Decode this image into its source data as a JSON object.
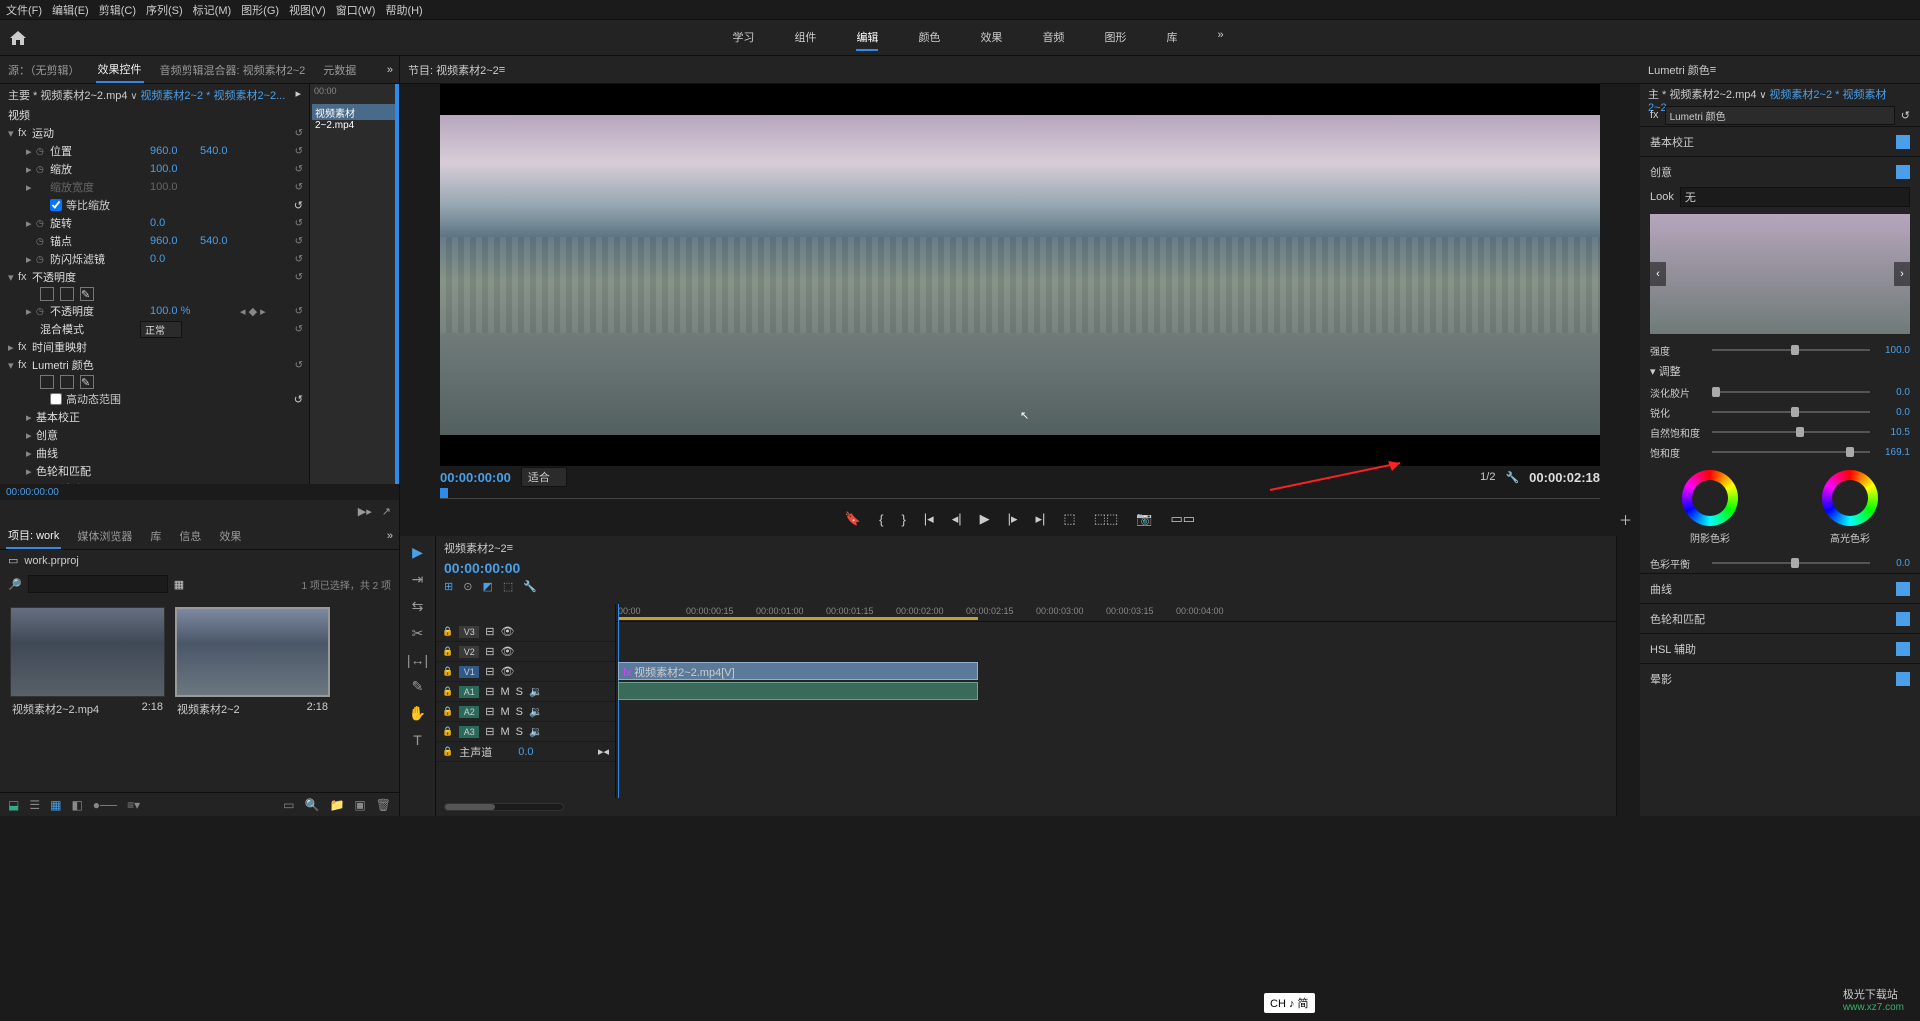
{
  "menu": {
    "file": "文件(F)",
    "edit": "编辑(E)",
    "clip": "剪辑(C)",
    "sequence": "序列(S)",
    "markers": "标记(M)",
    "graphics": "图形(G)",
    "view": "视图(V)",
    "window": "窗口(W)",
    "help": "帮助(H)"
  },
  "workspaces": {
    "learn": "学习",
    "assembly": "组件",
    "editing": "编辑",
    "color": "颜色",
    "effects": "效果",
    "audio": "音频",
    "graphics": "图形",
    "libraries": "库"
  },
  "source_tabs": {
    "source": "源：（无剪辑）",
    "effect_controls": "效果控件",
    "audio_mixer": "音频剪辑混合器: 视频素材2~2",
    "metadata": "元数据"
  },
  "effect": {
    "crumb_main": "主要 * 视频素材2~2.mp4",
    "crumb_link": "视频素材2~2 * 视频素材2~2...",
    "clip_tag": "视频素材2~2.mp4",
    "ruler_start": "00:00",
    "video_header": "视频",
    "motion": {
      "label": "运动",
      "position": "位置",
      "pos_x": "960.0",
      "pos_y": "540.0",
      "scale": "缩放",
      "scale_v": "100.0",
      "scale_width": "缩放宽度",
      "scale_width_v": "100.0",
      "uniform": "等比缩放",
      "rotation": "旋转",
      "rotation_v": "0.0",
      "anchor": "锚点",
      "anchor_x": "960.0",
      "anchor_y": "540.0",
      "antiflicker": "防闪烁滤镜",
      "antiflicker_v": "0.0"
    },
    "opacity": {
      "label": "不透明度",
      "value_lbl": "不透明度",
      "value": "100.0 %",
      "blend_lbl": "混合模式",
      "blend_v": "正常"
    },
    "time_remap": "时间重映射",
    "lumetri": {
      "label": "Lumetri 颜色",
      "hdr": "高动态范围",
      "basic": "基本校正",
      "creative": "创意",
      "curves": "曲线",
      "wheels": "色轮和匹配",
      "hsl": "HSL 辅助"
    },
    "timecode": "00:00:00:00"
  },
  "program": {
    "tab": "节目: 视频素材2~2",
    "tc": "00:00:00:00",
    "fit": "适合",
    "zoom": "1/2",
    "duration": "00:00:02:18"
  },
  "project": {
    "tab_project": "项目: work",
    "tab_browser": "媒体浏览器",
    "tab_lib": "库",
    "tab_info": "信息",
    "tab_effects": "效果",
    "path": "work.prproj",
    "search_placeholder": "",
    "status": "1 项已选择，共 2 项",
    "items": [
      {
        "name": "视频素材2~2.mp4",
        "dur": "2:18"
      },
      {
        "name": "视频素材2~2",
        "dur": "2:18"
      }
    ]
  },
  "timeline": {
    "tab": "视频素材2~2",
    "tc": "00:00:00:00",
    "ticks": [
      "00:00",
      "00:00:00:15",
      "00:00:01:00",
      "00:00:01:15",
      "00:00:02:00",
      "00:00:02:15",
      "00:00:03:00",
      "00:00:03:15",
      "00:00:04:00"
    ],
    "tracks": {
      "v3": "V3",
      "v2": "V2",
      "v1": "V1",
      "a1": "A1",
      "a2": "A2",
      "a3": "A3",
      "master": "主声道",
      "master_v": "0.0"
    },
    "clip_name": "视频素材2~2.mp4[V]",
    "ms": "M",
    "ss": "S"
  },
  "lumetri": {
    "title": "Lumetri 颜色",
    "crumb1": "主 * 视频素材2~2.mp4",
    "crumb2": "视频素材2~2 * 视频素材2~2...",
    "fx": "fx",
    "preset": "Lumetri 颜色",
    "basic": "基本校正",
    "creative": "创意",
    "look_lbl": "Look",
    "look_v": "无",
    "intensity": "强度",
    "intensity_v": "100.0",
    "adjust": "调整",
    "fade": "淡化胶片",
    "fade_v": "0.0",
    "sharpen": "锐化",
    "sharpen_v": "0.0",
    "vibrance": "自然饱和度",
    "vibrance_v": "10.5",
    "saturation": "饱和度",
    "saturation_v": "169.1",
    "shadow_tint": "阴影色彩",
    "highlight_tint": "高光色彩",
    "balance": "色彩平衡",
    "balance_v": "0.0",
    "curves": "曲线",
    "wheels": "色轮和匹配",
    "hsl": "HSL 辅助",
    "vignette": "晕影"
  },
  "ime": "CH ♪ 简",
  "watermark": {
    "l1": "极光下载站",
    "l2": "www.xz7.com"
  }
}
